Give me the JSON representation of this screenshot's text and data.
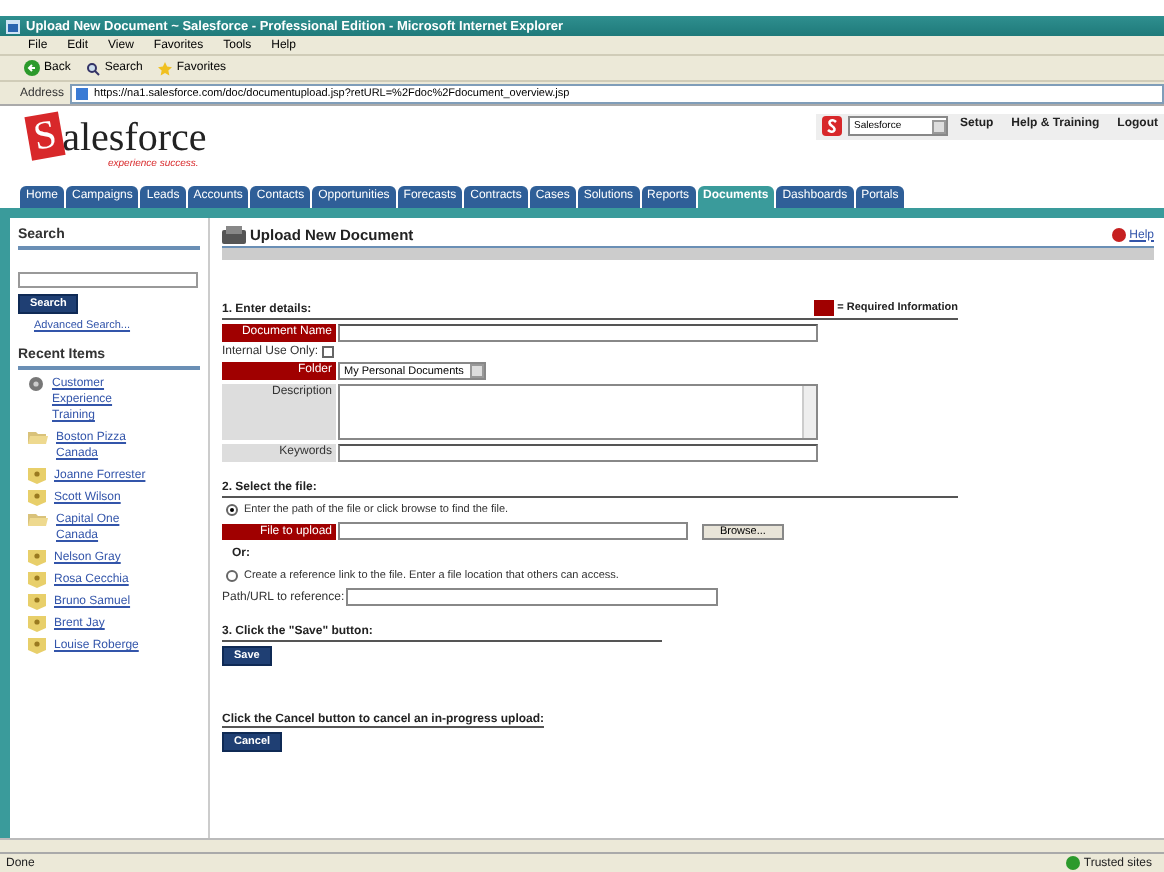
{
  "window": {
    "title": "Upload New Document ~ Salesforce - Professional Edition - Microsoft Internet Explorer"
  },
  "menu": [
    "File",
    "Edit",
    "View",
    "Favorites",
    "Tools",
    "Help"
  ],
  "toolbar": [
    {
      "kind": "back",
      "label": "Back"
    },
    {
      "kind": "search",
      "label": "Search"
    },
    {
      "kind": "favorites",
      "label": "Favorites"
    }
  ],
  "address": {
    "label": "Address",
    "url": "https://na1.salesforce.com/doc/documentupload.jsp?retURL=%2Fdoc%2Fdocument_overview.jsp"
  },
  "header": {
    "logo": {
      "initial": "S",
      "rest": "alesforce",
      "tagline": "experience success."
    },
    "app_select": "Salesforce",
    "links": [
      "Setup",
      "Help & Training",
      "Logout"
    ]
  },
  "tabs": [
    {
      "label": "Home",
      "selected": false
    },
    {
      "label": "Campaigns",
      "selected": false
    },
    {
      "label": "Leads",
      "selected": false
    },
    {
      "label": "Accounts",
      "selected": false
    },
    {
      "label": "Contacts",
      "selected": false
    },
    {
      "label": "Opportunities",
      "selected": false
    },
    {
      "label": "Forecasts",
      "selected": false
    },
    {
      "label": "Contracts",
      "selected": false
    },
    {
      "label": "Cases",
      "selected": false
    },
    {
      "label": "Solutions",
      "selected": false
    },
    {
      "label": "Reports",
      "selected": false
    },
    {
      "label": "Documents",
      "selected": true
    },
    {
      "label": "Dashboards",
      "selected": false
    },
    {
      "label": "Portals",
      "selected": false
    }
  ],
  "sidebar": {
    "search": {
      "title": "Search",
      "button": "Search",
      "advanced": "Advanced Search..."
    },
    "recent": {
      "title": "Recent Items",
      "items": [
        {
          "kind": "campaign",
          "label": "Customer Experience Training"
        },
        {
          "kind": "account",
          "label": "Boston Pizza Canada"
        },
        {
          "kind": "contact",
          "label": "Joanne Forrester"
        },
        {
          "kind": "contact",
          "label": "Scott Wilson"
        },
        {
          "kind": "account",
          "label": "Capital One Canada"
        },
        {
          "kind": "contact",
          "label": "Nelson Gray"
        },
        {
          "kind": "contact",
          "label": "Rosa Cecchia"
        },
        {
          "kind": "contact",
          "label": "Bruno Samuel"
        },
        {
          "kind": "contact",
          "label": "Brent Jay"
        },
        {
          "kind": "contact",
          "label": "Louise Roberge"
        }
      ]
    }
  },
  "content": {
    "title": "Upload New Document",
    "help": "Help",
    "legend": "= Required Information",
    "step1": {
      "heading": "1. Enter details:",
      "fields": [
        {
          "kind": "text",
          "label": "Document Name",
          "required": true
        },
        {
          "kind": "checkbox",
          "label": "Internal Use Only:",
          "checked": false
        },
        {
          "kind": "select",
          "label": "Folder",
          "required": true,
          "value": "My Personal Documents"
        },
        {
          "kind": "textarea",
          "label": "Description",
          "required": false
        },
        {
          "kind": "text",
          "label": "Keywords",
          "required": false
        }
      ]
    },
    "step2": {
      "heading": "2. Select the file:",
      "options": [
        {
          "label": "Enter the path of the file or click browse to find the file.",
          "selected": true
        },
        {
          "label": "Create a reference link to the file. Enter a file location that others can access.",
          "selected": false
        }
      ],
      "file_label": "File to upload",
      "browse": "Browse...",
      "or": "Or:",
      "path_label": "Path/URL to reference:"
    },
    "step3": {
      "heading": "3. Click the \"Save\" button:",
      "button": "Save"
    },
    "cancel": {
      "text": "Click the Cancel button to cancel an in-progress upload:",
      "button": "Cancel"
    }
  },
  "status_bar": {
    "text": "Done",
    "zone": "Trusted sites"
  }
}
